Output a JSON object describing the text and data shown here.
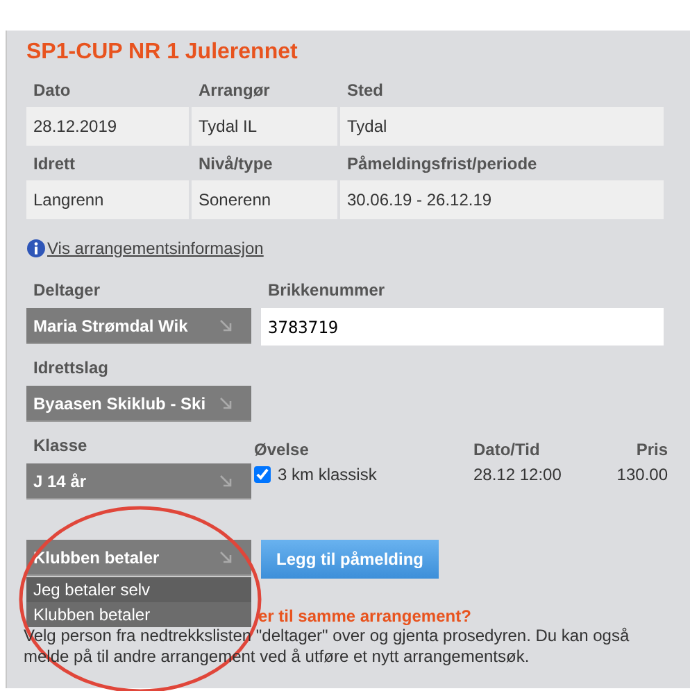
{
  "title": "SP1-CUP NR 1 Julerennet",
  "info_table": [
    {
      "headers": [
        "Dato",
        "Arrangør",
        "Sted"
      ],
      "values": [
        "28.12.2019",
        "Tydal IL",
        "Tydal"
      ]
    },
    {
      "headers": [
        "Idrett",
        "Nivå/type",
        "Påmeldingsfrist/periode"
      ],
      "values": [
        "Langrenn",
        "Sonerenn",
        "30.06.19 - 26.12.19"
      ]
    }
  ],
  "info_link": "Vis arrangementsinformasjon",
  "participant": {
    "label": "Deltager",
    "value": "Maria Strømdal Wik"
  },
  "chip": {
    "label": "Brikkenummer",
    "value": "3783719"
  },
  "club": {
    "label": "Idrettslag",
    "value": "Byaasen Skiklub - Ski"
  },
  "class": {
    "label": "Klasse",
    "value": "J 14 år"
  },
  "events": {
    "columns": [
      "Øvelse",
      "Dato/Tid",
      "Pris"
    ],
    "rows": [
      {
        "checked": true,
        "name": "3 km klassisk",
        "datetime": "28.12 12:00",
        "price": "130.00"
      }
    ]
  },
  "payment": {
    "value": "Klubben betaler",
    "expanded": true,
    "options": [
      {
        "label": "Jeg betaler selv",
        "highlighted": true
      },
      {
        "label": "Klubben betaler",
        "highlighted": false
      }
    ]
  },
  "add_button": "Legg til påmelding",
  "question": "er til samme arrangement?",
  "help_text": "Velg person fra nedtrekkslisten \"deltager\" over og gjenta prosedyren. Du kan også melde på til andre arrangement ved å utføre et nytt arrangementsøk.",
  "annotation": {
    "kind": "circle"
  }
}
